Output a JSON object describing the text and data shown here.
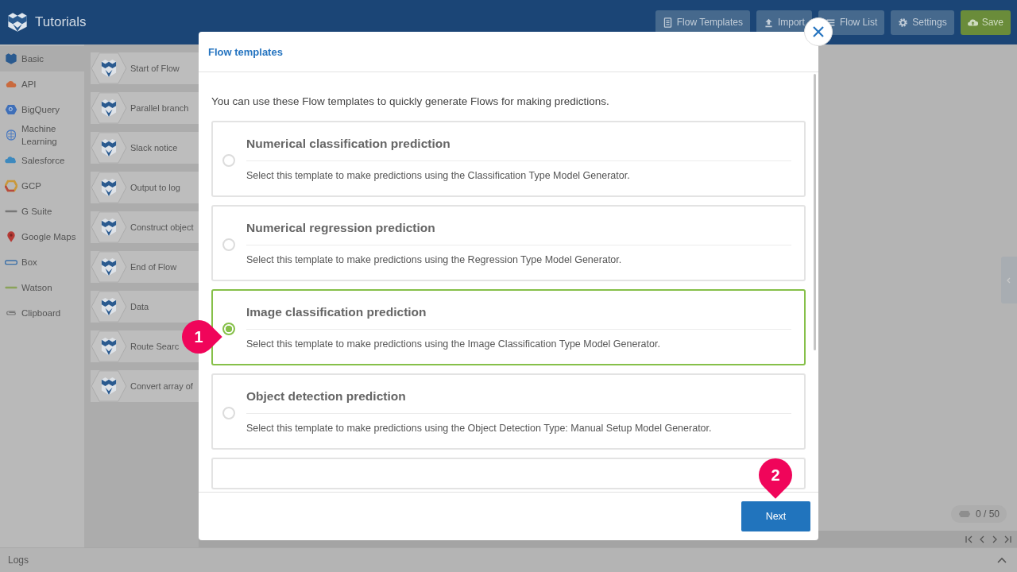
{
  "app": {
    "title": "Tutorials"
  },
  "toolbar": [
    {
      "label": "Flow Templates",
      "kind": "templates"
    },
    {
      "label": "Import",
      "kind": "import"
    },
    {
      "label": "Flow List",
      "kind": "list"
    },
    {
      "label": "Settings",
      "kind": "settings"
    },
    {
      "label": "Save",
      "kind": "save"
    }
  ],
  "sidebar": {
    "items": [
      {
        "label": "Basic",
        "kind": "basic",
        "selected": true
      },
      {
        "label": "API",
        "kind": "api",
        "selected": false
      },
      {
        "label": "BigQuery",
        "kind": "bigquery",
        "selected": false
      },
      {
        "label": "Machine Learning",
        "kind": "ml",
        "selected": false
      },
      {
        "label": "Salesforce",
        "kind": "salesforce",
        "selected": false
      },
      {
        "label": "GCP",
        "kind": "gcp",
        "selected": false
      },
      {
        "label": "G Suite",
        "kind": "gsuite",
        "selected": false
      },
      {
        "label": "Google Maps",
        "kind": "maps",
        "selected": false
      },
      {
        "label": "Box",
        "kind": "box",
        "selected": false
      },
      {
        "label": "Watson",
        "kind": "watson",
        "selected": false
      },
      {
        "label": "Clipboard",
        "kind": "clipboard",
        "selected": false
      }
    ]
  },
  "palette": {
    "items": [
      "Start of Flow",
      "Parallel branch",
      "Slack notice",
      "Output to log",
      "Construct object",
      "End of Flow",
      "Data",
      "Route Searc",
      "Convert array of"
    ]
  },
  "counter": "0 / 50",
  "logs": "Logs",
  "dialog": {
    "title": "Flow templates",
    "intro": "You can use these Flow templates to quickly generate Flows for making predictions.",
    "templates": [
      {
        "title": "Numerical classification prediction",
        "description": "Select this template to make predictions using the Classification Type Model Generator.",
        "selected": false
      },
      {
        "title": "Numerical regression prediction",
        "description": "Select this template to make predictions using the Regression Type Model Generator.",
        "selected": false
      },
      {
        "title": "Image classification prediction",
        "description": "Select this template to make predictions using the Image Classification Type Model Generator.",
        "selected": true
      },
      {
        "title": "Object detection prediction",
        "description": "Select this template to make predictions using the Object Detection Type: Manual Setup Model Generator.",
        "selected": false
      }
    ],
    "next_button": "Next"
  },
  "annotations": [
    {
      "label": "1",
      "kind": "left"
    },
    {
      "label": "2",
      "kind": "down"
    }
  ]
}
